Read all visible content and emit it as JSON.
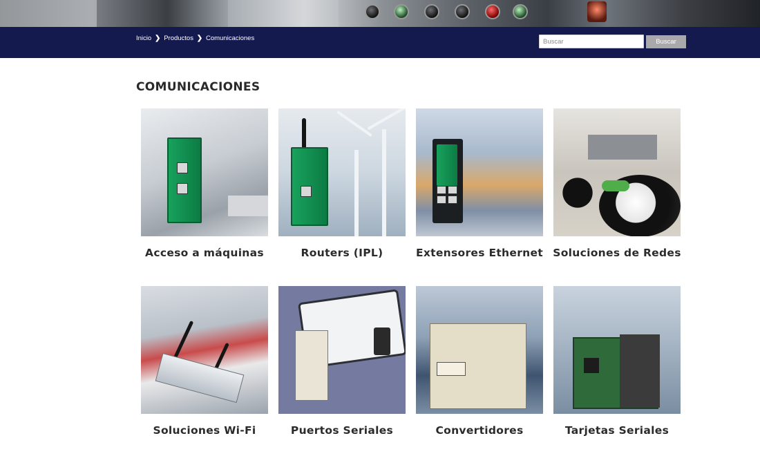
{
  "breadcrumb": {
    "items": [
      "Inicio",
      "Productos",
      "Comunicaciones"
    ]
  },
  "search": {
    "placeholder": "Buscar",
    "button_label": "Buscar"
  },
  "page_title": "COMUNICACIONES",
  "products": [
    {
      "label": "Acceso a máquinas"
    },
    {
      "label": "Routers (IPL)"
    },
    {
      "label": "Extensores Ethernet"
    },
    {
      "label": "Soluciones de Redes"
    },
    {
      "label": "Soluciones Wi-Fi"
    },
    {
      "label": "Puertos Seriales"
    },
    {
      "label": "Convertidores"
    },
    {
      "label": "Tarjetas Seriales"
    }
  ],
  "colors": {
    "navbar": "#141a4e",
    "search_button": "#a9a9ab",
    "title_text": "#2a2a2a"
  }
}
